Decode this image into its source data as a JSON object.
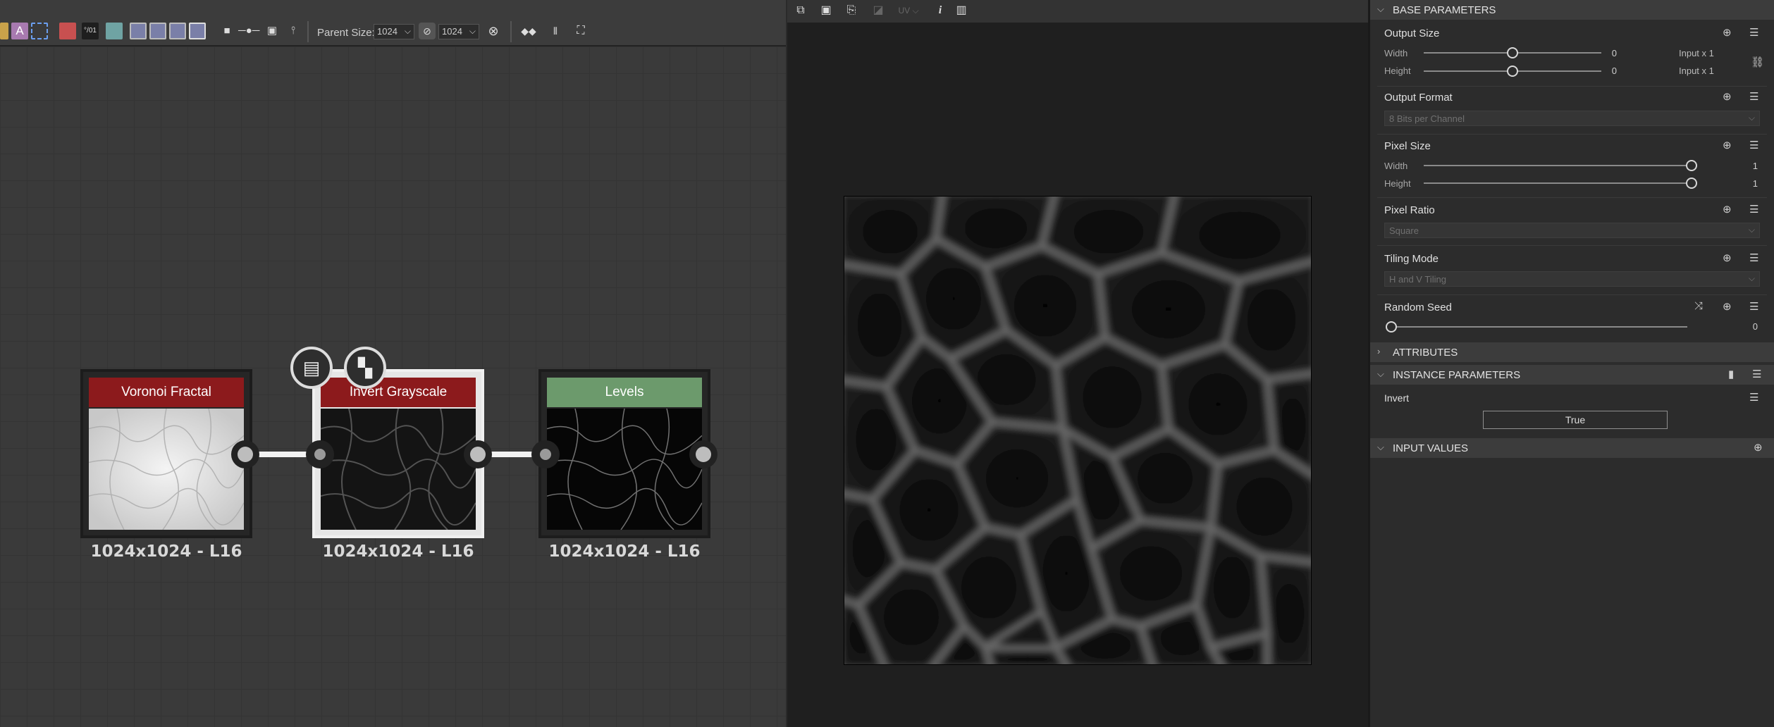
{
  "graph_toolbar": {
    "parent_size_label": "Parent Size:",
    "parent_size_value": "1024",
    "size_value": "1024"
  },
  "nodes": [
    {
      "title": "Voronoi Fractal",
      "label": "1024x1024 - L16",
      "header_color": "#8c1a1c"
    },
    {
      "title": "Invert Grayscale",
      "label": "1024x1024 - L16",
      "header_color": "#8c1a1c"
    },
    {
      "title": "Levels",
      "label": "1024x1024 - L16",
      "header_color": "#6c9a6c"
    }
  ],
  "viewer_toolbar": {
    "uv_label": "UV",
    "info_label": "i"
  },
  "properties": {
    "base_parameters": {
      "header": "BASE PARAMETERS",
      "output_size": {
        "label": "Output Size",
        "width_label": "Width",
        "width_value": "0",
        "width_mode": "Input x 1",
        "height_label": "Height",
        "height_value": "0",
        "height_mode": "Input x 1"
      },
      "output_format": {
        "label": "Output Format",
        "value": "8 Bits per Channel"
      },
      "pixel_size": {
        "label": "Pixel Size",
        "width_label": "Width",
        "width_value": "1",
        "height_label": "Height",
        "height_value": "1"
      },
      "pixel_ratio": {
        "label": "Pixel Ratio",
        "value": "Square"
      },
      "tiling_mode": {
        "label": "Tiling Mode",
        "value": "H and V Tiling"
      },
      "random_seed": {
        "label": "Random Seed",
        "value": "0"
      }
    },
    "attributes": {
      "header": "ATTRIBUTES"
    },
    "instance_parameters": {
      "header": "INSTANCE PARAMETERS",
      "invert_label": "Invert",
      "invert_value": "True"
    },
    "input_values": {
      "header": "INPUT VALUES"
    }
  }
}
